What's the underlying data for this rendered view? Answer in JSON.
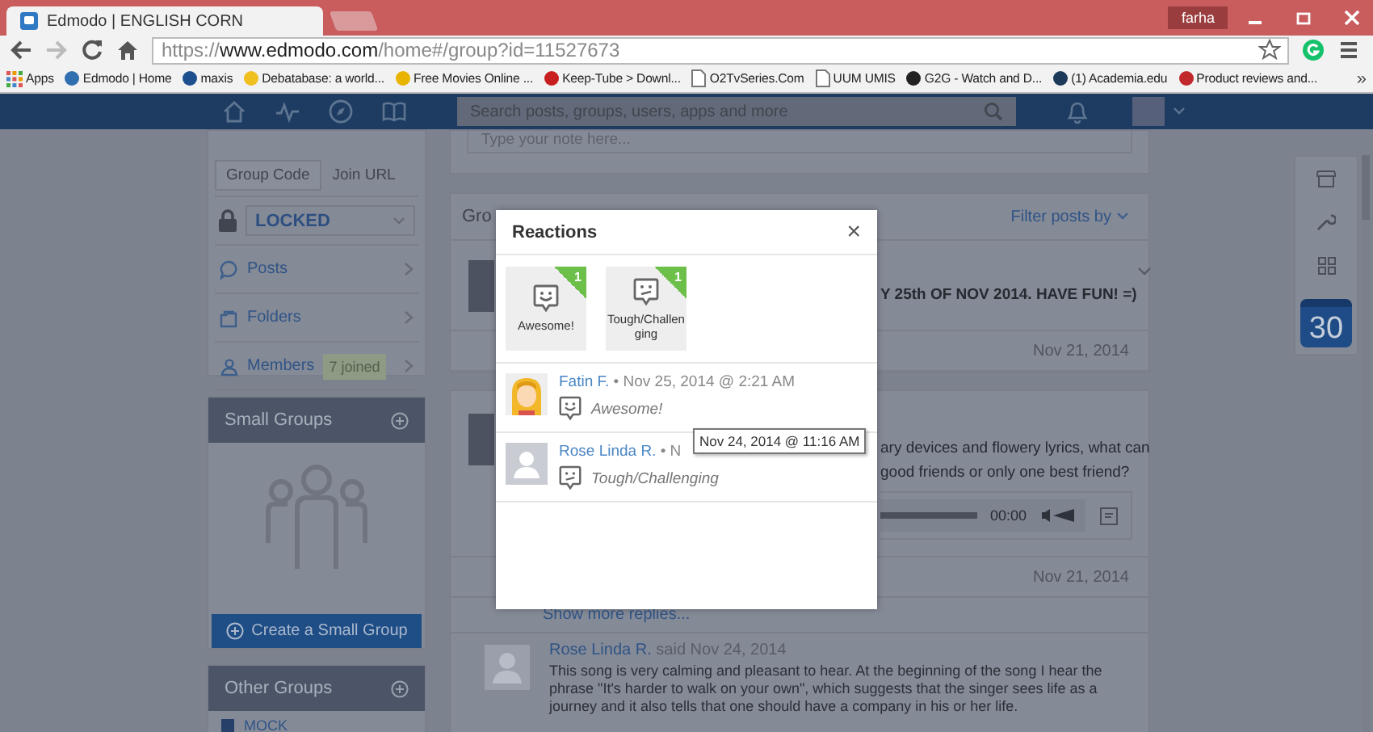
{
  "browser": {
    "tabs": [
      {
        "title": "Edmodo | ENGLISH CORN",
        "selected": true
      }
    ],
    "user": "farha",
    "url": {
      "scheme": "https://",
      "host": "www.edmodo.com",
      "path": "/home#/group?id=11527673"
    },
    "bookmarks": [
      {
        "label": "Apps",
        "kind": "apps"
      },
      {
        "label": "Edmodo | Home",
        "kind": "favicon",
        "color": "#2f6fb0"
      },
      {
        "label": "maxis",
        "kind": "favicon",
        "color": "#1d4f8f"
      },
      {
        "label": "Debatabase: a world...",
        "kind": "favicon",
        "color": "#f0c020"
      },
      {
        "label": "Free Movies Online ...",
        "kind": "favicon",
        "color": "#e8b400"
      },
      {
        "label": "Keep-Tube > Downl...",
        "kind": "favicon",
        "color": "#c81e1e"
      },
      {
        "label": "O2TvSeries.Com",
        "kind": "page"
      },
      {
        "label": "UUM UMIS",
        "kind": "page"
      },
      {
        "label": "G2G - Watch and D...",
        "kind": "favicon",
        "color": "#222222"
      },
      {
        "label": "(1) Academia.edu",
        "kind": "favicon",
        "color": "#1e3a5a"
      },
      {
        "label": "Product reviews and...",
        "kind": "favicon",
        "color": "#c0282b"
      }
    ],
    "more": "»"
  },
  "nav": {
    "search_placeholder": "Search posts, groups, users, apps and more"
  },
  "sidebar": {
    "code_tabs": [
      {
        "label": "Group Code",
        "selected": true
      },
      {
        "label": "Join URL",
        "selected": false
      }
    ],
    "lock": "LOCKED",
    "items": [
      {
        "label": "Posts",
        "kind": "posts"
      },
      {
        "label": "Folders",
        "kind": "folders"
      },
      {
        "label": "Members",
        "kind": "members",
        "badge": "7 joined"
      }
    ],
    "small_groups": {
      "title": "Small Groups",
      "button": "Create a Small Group"
    },
    "other_groups": {
      "title": "Other Groups",
      "items": [
        "MOCK"
      ]
    }
  },
  "feed": {
    "note_placeholder": "Type your note here...",
    "header_visible": "Gro",
    "filter": "Filter posts by",
    "post_1": {
      "text": "Y 25th OF NOV 2014. HAVE FUN! =)",
      "date": "Nov 21, 2014"
    },
    "post_2": {
      "lines": [
        "ary devices and flowery lyrics, what can",
        "good friends or only one best friend?"
      ],
      "audio_time": "00:00",
      "date": "Nov 21, 2014"
    },
    "show_more": "Show more replies...",
    "comment": {
      "author": "Rose Linda R.",
      "meta": "said Nov 24, 2014",
      "text": "This song is very calming and pleasant to hear. At the beginning of the song I hear the phrase \"It's harder to walk on your own\", which suggests that the singer sees life as a journey and it also tells that one should have a company in his or her life."
    }
  },
  "rail": {
    "calendar_day": "30"
  },
  "modal": {
    "title": "Reactions",
    "close": "×",
    "reactions": [
      {
        "label": "Awesome!",
        "count": "1",
        "kind": "smile"
      },
      {
        "label": "Tough/Challenging",
        "count": "1",
        "kind": "confused"
      }
    ],
    "entries": [
      {
        "name": "Fatin F.",
        "meta": "• Nov 25, 2014 @ 2:21 AM",
        "reaction": "Awesome!",
        "kind": "smile",
        "avatar": {
          "kind": "cartoon"
        }
      },
      {
        "name": "Rose Linda R.",
        "meta": "• N",
        "reaction": "Tough/Challenging",
        "kind": "confused",
        "avatar": {
          "kind": "silhouette"
        }
      }
    ],
    "tooltip": "Nov 24, 2014 @ 11:16 AM"
  }
}
